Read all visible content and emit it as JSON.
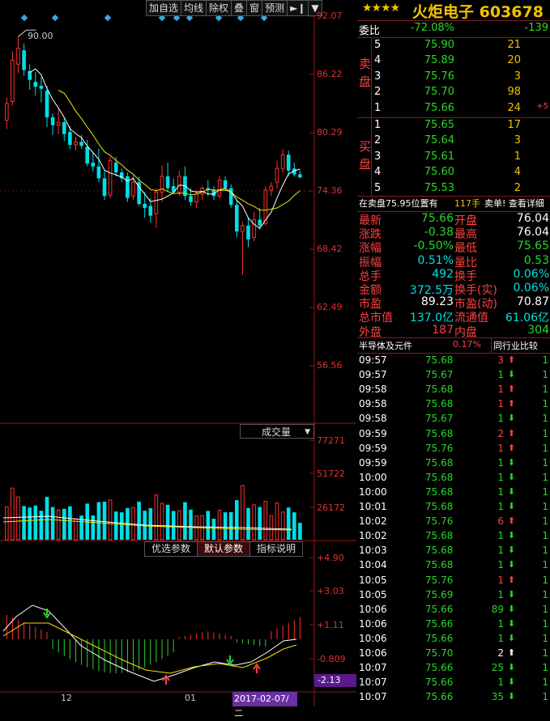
{
  "toolbar": {
    "buttons": [
      "加自选",
      "均线",
      "除权",
      "叠",
      "窗",
      "预测"
    ]
  },
  "chart": {
    "price_ticks": [
      "92.07",
      "86.22",
      "80.29",
      "74.36",
      "68.42",
      "62.49",
      "56.56"
    ],
    "max_label": "90.00",
    "volume_title": "成交量",
    "volume_ticks": [
      "77271",
      "51722",
      "26172"
    ],
    "param_tabs": [
      "优选参数",
      "默认参数",
      "指标说明"
    ],
    "macd_ticks": [
      "+4.90",
      "+3.03",
      "+1.11",
      "-0.809"
    ],
    "macd_current": "-2.13",
    "x_labels": [
      "12",
      "01"
    ],
    "cursor_date": "2017-02-07/二",
    "colors": {
      "up": "#ff3030",
      "down": "#00dfe6",
      "ma5": "#ffffff",
      "ma10": "#f2e200"
    }
  },
  "chart_data": {
    "type": "candlestick",
    "candles": [
      {
        "o": 81.5,
        "h": 83.8,
        "l": 80.6,
        "c": 83.2
      },
      {
        "o": 83.4,
        "h": 88.5,
        "l": 83.0,
        "c": 87.6
      },
      {
        "o": 87.2,
        "h": 90.0,
        "l": 86.3,
        "c": 88.8
      },
      {
        "o": 88.6,
        "h": 89.3,
        "l": 86.0,
        "c": 86.6
      },
      {
        "o": 86.5,
        "h": 87.2,
        "l": 84.6,
        "c": 85.6
      },
      {
        "o": 85.4,
        "h": 86.4,
        "l": 84.0,
        "c": 84.9
      },
      {
        "o": 85.0,
        "h": 85.9,
        "l": 83.3,
        "c": 84.7
      },
      {
        "o": 84.5,
        "h": 85.0,
        "l": 80.8,
        "c": 81.8
      },
      {
        "o": 81.8,
        "h": 82.2,
        "l": 80.0,
        "c": 81.0
      },
      {
        "o": 81.0,
        "h": 82.8,
        "l": 80.1,
        "c": 81.3
      },
      {
        "o": 81.3,
        "h": 81.8,
        "l": 79.4,
        "c": 80.1
      },
      {
        "o": 80.3,
        "h": 80.9,
        "l": 78.6,
        "c": 79.0
      },
      {
        "o": 79.0,
        "h": 79.8,
        "l": 78.4,
        "c": 79.3
      },
      {
        "o": 79.3,
        "h": 80.0,
        "l": 78.6,
        "c": 78.9
      },
      {
        "o": 78.8,
        "h": 79.5,
        "l": 76.8,
        "c": 77.1
      },
      {
        "o": 77.2,
        "h": 78.2,
        "l": 76.3,
        "c": 76.8
      },
      {
        "o": 76.8,
        "h": 78.6,
        "l": 75.2,
        "c": 75.6
      },
      {
        "o": 75.6,
        "h": 76.4,
        "l": 73.4,
        "c": 73.8
      },
      {
        "o": 73.9,
        "h": 77.8,
        "l": 73.6,
        "c": 77.4
      },
      {
        "o": 77.2,
        "h": 77.8,
        "l": 75.8,
        "c": 76.2
      },
      {
        "o": 76.2,
        "h": 76.6,
        "l": 75.2,
        "c": 75.6
      },
      {
        "o": 75.8,
        "h": 76.2,
        "l": 73.2,
        "c": 73.6
      },
      {
        "o": 73.8,
        "h": 76.0,
        "l": 73.4,
        "c": 75.2
      },
      {
        "o": 75.2,
        "h": 75.8,
        "l": 72.8,
        "c": 73.0
      },
      {
        "o": 73.0,
        "h": 74.2,
        "l": 71.6,
        "c": 72.6
      },
      {
        "o": 72.8,
        "h": 73.6,
        "l": 71.1,
        "c": 71.8
      },
      {
        "o": 72.0,
        "h": 74.6,
        "l": 70.6,
        "c": 74.2
      },
      {
        "o": 74.2,
        "h": 76.9,
        "l": 73.2,
        "c": 75.8
      },
      {
        "o": 75.8,
        "h": 77.2,
        "l": 74.2,
        "c": 74.6
      },
      {
        "o": 74.8,
        "h": 75.6,
        "l": 74.0,
        "c": 74.2
      },
      {
        "o": 74.2,
        "h": 76.4,
        "l": 73.8,
        "c": 75.8
      },
      {
        "o": 75.8,
        "h": 76.8,
        "l": 73.4,
        "c": 73.8
      },
      {
        "o": 73.8,
        "h": 74.6,
        "l": 72.8,
        "c": 73.2
      },
      {
        "o": 73.2,
        "h": 74.4,
        "l": 72.6,
        "c": 74.0
      },
      {
        "o": 74.0,
        "h": 74.8,
        "l": 73.4,
        "c": 74.6
      },
      {
        "o": 74.6,
        "h": 75.4,
        "l": 73.8,
        "c": 74.4
      },
      {
        "o": 74.4,
        "h": 74.8,
        "l": 73.4,
        "c": 73.8
      },
      {
        "o": 73.8,
        "h": 75.8,
        "l": 73.6,
        "c": 75.4
      },
      {
        "o": 75.4,
        "h": 75.8,
        "l": 74.4,
        "c": 74.6
      },
      {
        "o": 74.6,
        "h": 75.0,
        "l": 72.6,
        "c": 72.9
      },
      {
        "o": 72.9,
        "h": 73.3,
        "l": 69.6,
        "c": 70.2
      },
      {
        "o": 70.2,
        "h": 71.2,
        "l": 65.8,
        "c": 70.8
      },
      {
        "o": 70.8,
        "h": 71.6,
        "l": 68.6,
        "c": 69.4
      },
      {
        "o": 69.6,
        "h": 72.2,
        "l": 69.2,
        "c": 71.4
      },
      {
        "o": 71.4,
        "h": 72.6,
        "l": 70.4,
        "c": 70.8
      },
      {
        "o": 71.0,
        "h": 74.8,
        "l": 70.8,
        "c": 74.4
      },
      {
        "o": 74.4,
        "h": 75.2,
        "l": 73.8,
        "c": 74.8
      },
      {
        "o": 75.2,
        "h": 77.4,
        "l": 74.6,
        "c": 76.6
      },
      {
        "o": 76.6,
        "h": 78.6,
        "l": 76.2,
        "c": 78.0
      },
      {
        "o": 78.0,
        "h": 78.4,
        "l": 75.8,
        "c": 76.4
      },
      {
        "o": 76.6,
        "h": 77.2,
        "l": 75.8,
        "c": 76.0
      },
      {
        "o": 76.0,
        "h": 76.4,
        "l": 75.6,
        "c": 75.7
      }
    ],
    "volume_up_pattern": "from candle direction",
    "ylim": [
      55.0,
      92.07
    ],
    "volume_ylim": [
      0,
      77271
    ],
    "macd_ylim": [
      -2.6,
      4.9
    ]
  },
  "quote": {
    "stars": "★★★★",
    "title": "火炬电子 603678",
    "weibi_label": "委比",
    "weibi_pct": "-72.08%",
    "weibi_val": "-139",
    "sell_label": [
      "卖",
      "盘"
    ],
    "buy_label": [
      "买",
      "盘"
    ],
    "sell": [
      {
        "lv": "5",
        "price": "75.90",
        "vol": "21",
        "extra": ""
      },
      {
        "lv": "4",
        "price": "75.89",
        "vol": "20",
        "extra": ""
      },
      {
        "lv": "3",
        "price": "75.76",
        "vol": "3",
        "extra": ""
      },
      {
        "lv": "2",
        "price": "75.70",
        "vol": "98",
        "extra": ""
      },
      {
        "lv": "1",
        "price": "75.66",
        "vol": "24",
        "extra": "+5"
      }
    ],
    "buy": [
      {
        "lv": "1",
        "price": "75.65",
        "vol": "17"
      },
      {
        "lv": "2",
        "price": "75.64",
        "vol": "3"
      },
      {
        "lv": "3",
        "price": "75.61",
        "vol": "1"
      },
      {
        "lv": "4",
        "price": "75.60",
        "vol": "4"
      },
      {
        "lv": "5",
        "price": "75.53",
        "vol": "2"
      }
    ],
    "notice_left": "在卖盘75.95位置有",
    "notice_hand": "117手",
    "notice_right": "卖单! 查看详细",
    "stats": [
      {
        "l1": "最新",
        "v1": "75.66",
        "c1": "green",
        "l2": "开盘",
        "v2": "76.04",
        "c2": "white"
      },
      {
        "l1": "涨跌",
        "v1": "-0.38",
        "c1": "green",
        "l2": "最高",
        "v2": "76.04",
        "c2": "white"
      },
      {
        "l1": "涨幅",
        "v1": "-0.50%",
        "c1": "green",
        "l2": "最低",
        "v2": "75.65",
        "c2": "green"
      },
      {
        "l1": "振幅",
        "v1": "0.51%",
        "c1": "cyan",
        "l2": "量比",
        "v2": "0.53",
        "c2": "green"
      },
      {
        "l1": "总手",
        "v1": "492",
        "c1": "cyan",
        "l2": "换手",
        "v2": "0.06%",
        "c2": "cyan"
      },
      {
        "l1": "金额",
        "v1": "372.5万",
        "c1": "cyan",
        "l2": "换手(实)",
        "v2": "0.06%",
        "c2": "cyan"
      },
      {
        "l1": "市盈",
        "v1": "89.23",
        "c1": "white",
        "l2": "市盈(动)",
        "v2": "70.87",
        "c2": "white"
      },
      {
        "l1": "总市值",
        "v1": "137.0亿",
        "c1": "cyan",
        "l2": "流通值",
        "v2": "61.06亿",
        "c2": "cyan"
      },
      {
        "l1": "外盘",
        "v1": "187",
        "c1": "red",
        "l2": "内盘",
        "v2": "304",
        "c2": "green"
      }
    ],
    "sector_name": "半导体及元件",
    "sector_pct": "0.17%",
    "sector_compare": "同行业比较",
    "ticks": [
      {
        "t": "09:57",
        "p": "75.68",
        "v": "3",
        "d": "up",
        "n": "1"
      },
      {
        "t": "09:57",
        "p": "75.67",
        "v": "1",
        "d": "down",
        "n": "1"
      },
      {
        "t": "09:58",
        "p": "75.68",
        "v": "1",
        "d": "up",
        "n": "1"
      },
      {
        "t": "09:58",
        "p": "75.68",
        "v": "1",
        "d": "up",
        "n": "1"
      },
      {
        "t": "09:58",
        "p": "75.67",
        "v": "1",
        "d": "down",
        "n": "1"
      },
      {
        "t": "09:59",
        "p": "75.68",
        "v": "2",
        "d": "up",
        "n": "1"
      },
      {
        "t": "09:59",
        "p": "75.76",
        "v": "1",
        "d": "up",
        "n": "1"
      },
      {
        "t": "09:59",
        "p": "75.68",
        "v": "1",
        "d": "down",
        "n": "1"
      },
      {
        "t": "10:00",
        "p": "75.68",
        "v": "1",
        "d": "down",
        "n": "1"
      },
      {
        "t": "10:00",
        "p": "75.68",
        "v": "1",
        "d": "down",
        "n": "1"
      },
      {
        "t": "10:01",
        "p": "75.68",
        "v": "1",
        "d": "down",
        "n": "1"
      },
      {
        "t": "10:02",
        "p": "75.76",
        "v": "6",
        "d": "up",
        "n": "1"
      },
      {
        "t": "10:02",
        "p": "75.68",
        "v": "1",
        "d": "down",
        "n": "1"
      },
      {
        "t": "10:03",
        "p": "75.68",
        "v": "1",
        "d": "down",
        "n": "1"
      },
      {
        "t": "10:04",
        "p": "75.68",
        "v": "1",
        "d": "down",
        "n": "1"
      },
      {
        "t": "10:05",
        "p": "75.76",
        "v": "1",
        "d": "up",
        "n": "1"
      },
      {
        "t": "10:05",
        "p": "75.69",
        "v": "1",
        "d": "down",
        "n": "1"
      },
      {
        "t": "10:06",
        "p": "75.66",
        "v": "89",
        "d": "down",
        "n": "1"
      },
      {
        "t": "10:06",
        "p": "75.66",
        "v": "1",
        "d": "down",
        "n": "1"
      },
      {
        "t": "10:06",
        "p": "75.66",
        "v": "1",
        "d": "down",
        "n": "1"
      },
      {
        "t": "10:06",
        "p": "75.70",
        "v": "2",
        "d": "neutral",
        "n": "1"
      },
      {
        "t": "10:07",
        "p": "75.66",
        "v": "25",
        "d": "down",
        "n": "1"
      },
      {
        "t": "10:07",
        "p": "75.66",
        "v": "1",
        "d": "down",
        "n": "1"
      },
      {
        "t": "10:07",
        "p": "75.66",
        "v": "35",
        "d": "down",
        "n": "1"
      }
    ]
  }
}
